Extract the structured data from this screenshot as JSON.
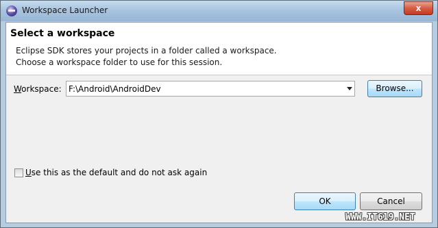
{
  "window": {
    "title": "Workspace Launcher",
    "close_glyph": "x"
  },
  "header": {
    "title": "Select a workspace",
    "description_line1": "Eclipse SDK stores your projects in a folder called a workspace.",
    "description_line2": "Choose a workspace folder to use for this session."
  },
  "workspace": {
    "label_mnemonic": "W",
    "label_rest": "orkspace:",
    "value": "F:\\Android\\AndroidDev",
    "browse_label": "Browse..."
  },
  "default_checkbox": {
    "checked": false,
    "label_mnemonic": "U",
    "label_rest": "se this as the default and do not ask again"
  },
  "buttons": {
    "ok": "OK",
    "cancel": "Cancel"
  },
  "watermark": "WWW.IT619.NET",
  "icons": {
    "app": "eclipse-icon",
    "close": "close-icon",
    "dropdown": "chevron-down-icon"
  }
}
